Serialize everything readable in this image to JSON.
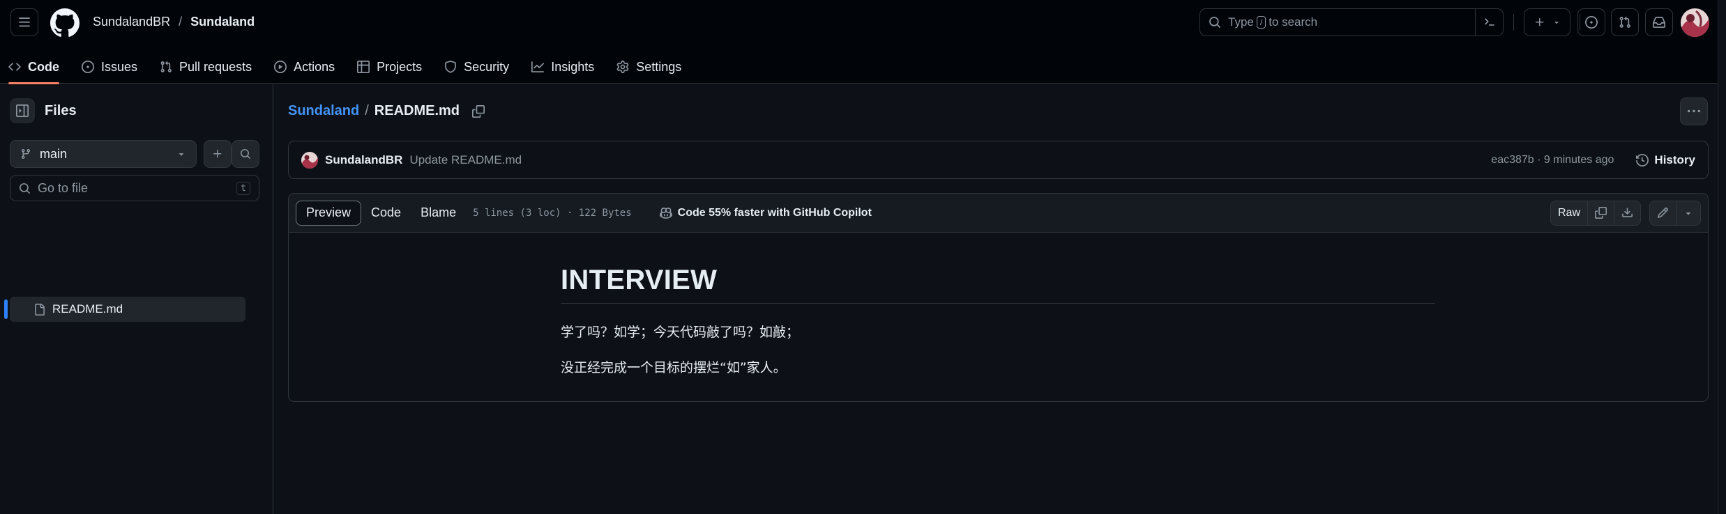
{
  "header": {
    "owner": "SundalandBR",
    "separator": "/",
    "repo": "Sundaland",
    "search": {
      "prefix": "Type",
      "key": "/",
      "suffix": "to search"
    }
  },
  "nav": {
    "tabs": [
      {
        "label": "Code",
        "icon": "code-icon",
        "active": true
      },
      {
        "label": "Issues",
        "icon": "issue-icon"
      },
      {
        "label": "Pull requests",
        "icon": "pull-request-icon"
      },
      {
        "label": "Actions",
        "icon": "play-icon"
      },
      {
        "label": "Projects",
        "icon": "table-icon"
      },
      {
        "label": "Security",
        "icon": "shield-icon"
      },
      {
        "label": "Insights",
        "icon": "graph-icon"
      },
      {
        "label": "Settings",
        "icon": "gear-icon"
      }
    ]
  },
  "sidebar": {
    "title": "Files",
    "branch": "main",
    "goto_placeholder": "Go to file",
    "goto_shortcut": "t",
    "files": [
      {
        "name": "README.md",
        "icon": "file-icon",
        "selected": true
      }
    ]
  },
  "file": {
    "root": "Sundaland",
    "separator": "/",
    "name": "README.md"
  },
  "commit": {
    "author": "SundalandBR",
    "message": "Update README.md",
    "meta": "eac387b · 9 minutes ago",
    "history_label": "History"
  },
  "viewer": {
    "tabs": [
      "Preview",
      "Code",
      "Blame"
    ],
    "active_tab": "Preview",
    "meta": "5 lines (3 loc) · 122 Bytes",
    "copilot": "Code 55% faster with GitHub Copilot",
    "raw_label": "Raw"
  },
  "markdown": {
    "heading": "INTERVIEW",
    "paragraphs": [
      "学了吗？如学；今天代码敲了吗？如敲；",
      "没正经完成一个目标的摆烂“如”家人。"
    ]
  },
  "colors": {
    "background": "#0d1117",
    "header_bg": "#010409",
    "border": "#30363d",
    "link": "#4493f8",
    "active_underline": "#f78166"
  }
}
